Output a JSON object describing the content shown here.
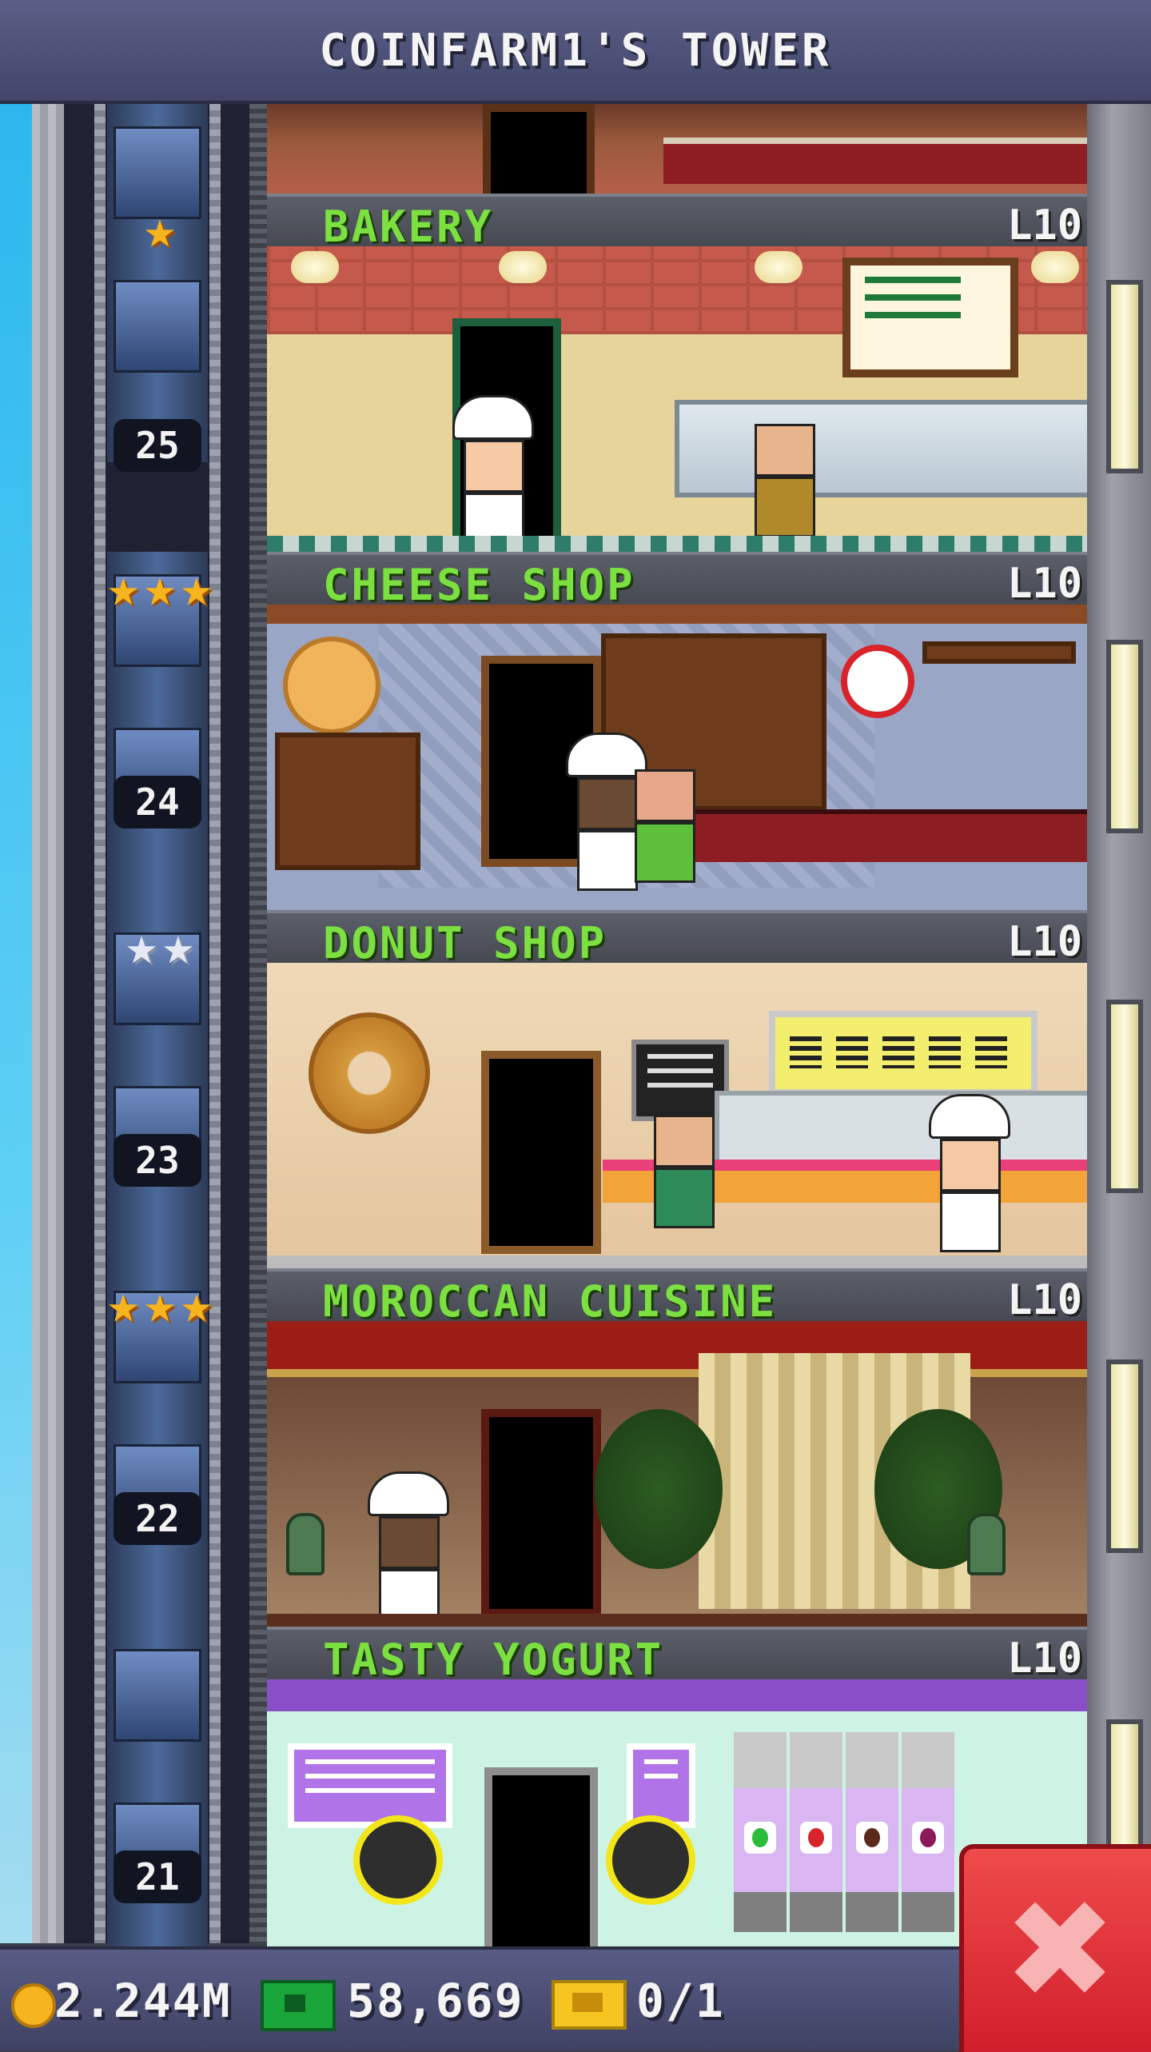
{
  "header": {
    "title": "COINFARM1'S TOWER"
  },
  "floors": [
    {
      "name": "BAKERY",
      "level": "L10",
      "floor_number": "25",
      "stars": {
        "count": 1,
        "type": "gold"
      }
    },
    {
      "name": "CHEESE SHOP",
      "level": "L10",
      "floor_number": "24",
      "stars": {
        "count": 3,
        "type": "gold"
      }
    },
    {
      "name": "DONUT SHOP",
      "level": "L10",
      "floor_number": "23",
      "stars": {
        "count": 2,
        "type": "silver"
      }
    },
    {
      "name": "MOROCCAN CUISINE",
      "level": "L10",
      "floor_number": "22",
      "stars": {
        "count": 3,
        "type": "gold"
      }
    },
    {
      "name": "TASTY YOGURT",
      "level": "L10",
      "floor_number": "21",
      "stars": {
        "count": 0,
        "type": "none"
      }
    }
  ],
  "statusbar": {
    "coins": "2.244M",
    "tower_bux": "58,669",
    "tickets": "0/1"
  },
  "icons": {
    "coins": "coin-icon",
    "bux": "tower-bux-icon",
    "tickets": "golden-ticket-icon",
    "close": "close-icon",
    "star": "star-icon"
  },
  "colors": {
    "floor_name": "#7be040",
    "header_bg": "#4e5177",
    "close_button": "#e0303a",
    "gold_star": "#f6b41f",
    "silver_star": "#e6e9f5"
  }
}
